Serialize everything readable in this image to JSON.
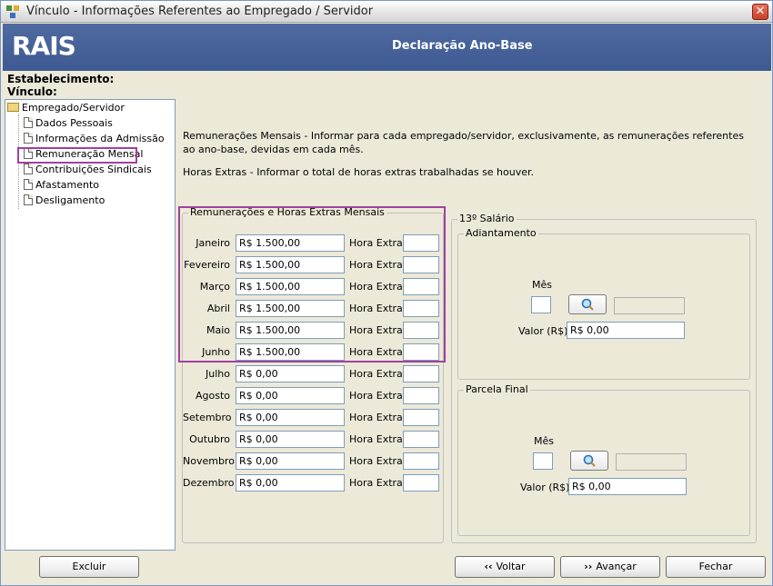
{
  "window": {
    "title": "Vínculo - Informações Referentes ao Empregado / Servidor",
    "close_label": "✕"
  },
  "header": {
    "logo": "RAIS",
    "title": "Declaração Ano-Base"
  },
  "labels": {
    "estabelecimento": "Estabelecimento:",
    "vinculo": "Vínculo:"
  },
  "tree": {
    "root": "Empregado/Servidor",
    "items": [
      {
        "label": "Dados Pessoais"
      },
      {
        "label": "Informações da Admissão"
      },
      {
        "label": "Remuneração Mensal"
      },
      {
        "label": "Contribuições Sindicais"
      },
      {
        "label": "Afastamento"
      },
      {
        "label": "Desligamento"
      }
    ]
  },
  "description": {
    "remuneracoes": "Remunerações Mensais - Informar para cada empregado/servidor, exclusivamente, as remunerações referentes ao ano-base, devidas em cada mês.",
    "horas_extras": "Horas Extras - Informar o total de horas extras trabalhadas se houver."
  },
  "monthly": {
    "legend": "Remunerações e Horas Extras Mensais",
    "hora_extra_label": "Hora Extra",
    "months": [
      {
        "name": "Janeiro",
        "value": "R$ 1.500,00",
        "hora_extra": ""
      },
      {
        "name": "Fevereiro",
        "value": "R$ 1.500,00",
        "hora_extra": ""
      },
      {
        "name": "Março",
        "value": "R$ 1.500,00",
        "hora_extra": ""
      },
      {
        "name": "Abril",
        "value": "R$ 1.500,00",
        "hora_extra": ""
      },
      {
        "name": "Maio",
        "value": "R$ 1.500,00",
        "hora_extra": ""
      },
      {
        "name": "Junho",
        "value": "R$ 1.500,00",
        "hora_extra": ""
      },
      {
        "name": "Julho",
        "value": "R$ 0,00",
        "hora_extra": ""
      },
      {
        "name": "Agosto",
        "value": "R$ 0,00",
        "hora_extra": ""
      },
      {
        "name": "Setembro",
        "value": "R$ 0,00",
        "hora_extra": ""
      },
      {
        "name": "Outubro",
        "value": "R$ 0,00",
        "hora_extra": ""
      },
      {
        "name": "Novembro",
        "value": "R$ 0,00",
        "hora_extra": ""
      },
      {
        "name": "Dezembro",
        "value": "R$ 0,00",
        "hora_extra": ""
      }
    ]
  },
  "salario13": {
    "legend": "13º Salário",
    "adiantamento": {
      "legend": "Adiantamento",
      "mes_label": "Mês",
      "mes_value": "",
      "valor_label": "Valor (R$)",
      "valor_value": "R$ 0,00"
    },
    "parcela_final": {
      "legend": "Parcela Final",
      "mes_label": "Mês",
      "mes_value": "",
      "valor_label": "Valor (R$)",
      "valor_value": "R$ 0,00"
    }
  },
  "buttons": {
    "excluir": "Excluir",
    "voltar": "Voltar",
    "avancar": "Avançar",
    "fechar": "Fechar"
  },
  "colors": {
    "header_bg": "#455f96",
    "highlight": "#a040a0",
    "window_bg": "#ece9d8"
  }
}
